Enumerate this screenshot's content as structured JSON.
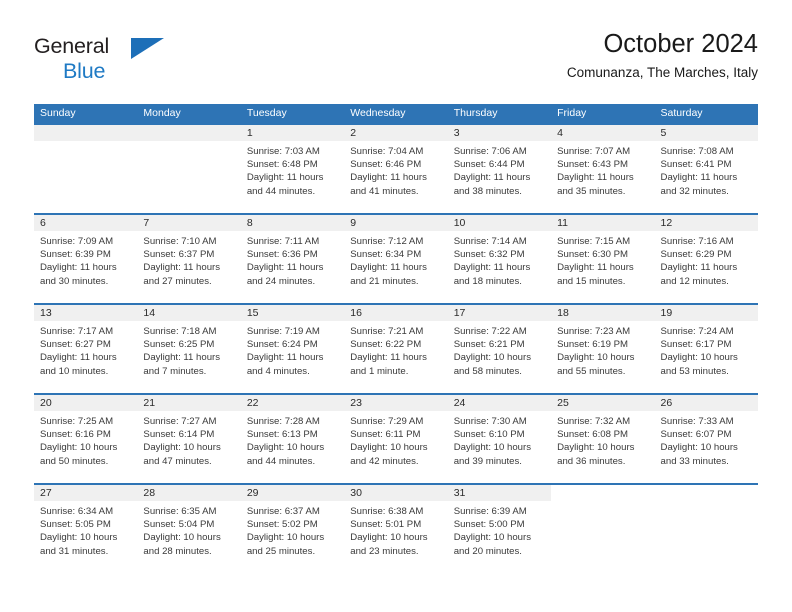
{
  "logo": {
    "line1": "General",
    "line2": "Blue",
    "triangle_color": "#1d6fb8"
  },
  "header": {
    "title": "October 2024",
    "subtitle": "Comunanza, The Marches, Italy"
  },
  "theme": {
    "header_blue": "#2E74B5",
    "day_band_gray": "#f0f0f0",
    "text": "#3a3a3a"
  },
  "weekdays": [
    "Sunday",
    "Monday",
    "Tuesday",
    "Wednesday",
    "Thursday",
    "Friday",
    "Saturday"
  ],
  "weeks": [
    [
      {
        "day": "",
        "blank": true,
        "sunrise": "",
        "sunset": "",
        "daylight_line1": "",
        "daylight_line2": ""
      },
      {
        "day": "",
        "blank": true,
        "sunrise": "",
        "sunset": "",
        "daylight_line1": "",
        "daylight_line2": ""
      },
      {
        "day": "1",
        "sunrise": "Sunrise: 7:03 AM",
        "sunset": "Sunset: 6:48 PM",
        "daylight_line1": "Daylight: 11 hours",
        "daylight_line2": "and 44 minutes."
      },
      {
        "day": "2",
        "sunrise": "Sunrise: 7:04 AM",
        "sunset": "Sunset: 6:46 PM",
        "daylight_line1": "Daylight: 11 hours",
        "daylight_line2": "and 41 minutes."
      },
      {
        "day": "3",
        "sunrise": "Sunrise: 7:06 AM",
        "sunset": "Sunset: 6:44 PM",
        "daylight_line1": "Daylight: 11 hours",
        "daylight_line2": "and 38 minutes."
      },
      {
        "day": "4",
        "sunrise": "Sunrise: 7:07 AM",
        "sunset": "Sunset: 6:43 PM",
        "daylight_line1": "Daylight: 11 hours",
        "daylight_line2": "and 35 minutes."
      },
      {
        "day": "5",
        "sunrise": "Sunrise: 7:08 AM",
        "sunset": "Sunset: 6:41 PM",
        "daylight_line1": "Daylight: 11 hours",
        "daylight_line2": "and 32 minutes."
      }
    ],
    [
      {
        "day": "6",
        "sunrise": "Sunrise: 7:09 AM",
        "sunset": "Sunset: 6:39 PM",
        "daylight_line1": "Daylight: 11 hours",
        "daylight_line2": "and 30 minutes."
      },
      {
        "day": "7",
        "sunrise": "Sunrise: 7:10 AM",
        "sunset": "Sunset: 6:37 PM",
        "daylight_line1": "Daylight: 11 hours",
        "daylight_line2": "and 27 minutes."
      },
      {
        "day": "8",
        "sunrise": "Sunrise: 7:11 AM",
        "sunset": "Sunset: 6:36 PM",
        "daylight_line1": "Daylight: 11 hours",
        "daylight_line2": "and 24 minutes."
      },
      {
        "day": "9",
        "sunrise": "Sunrise: 7:12 AM",
        "sunset": "Sunset: 6:34 PM",
        "daylight_line1": "Daylight: 11 hours",
        "daylight_line2": "and 21 minutes."
      },
      {
        "day": "10",
        "sunrise": "Sunrise: 7:14 AM",
        "sunset": "Sunset: 6:32 PM",
        "daylight_line1": "Daylight: 11 hours",
        "daylight_line2": "and 18 minutes."
      },
      {
        "day": "11",
        "sunrise": "Sunrise: 7:15 AM",
        "sunset": "Sunset: 6:30 PM",
        "daylight_line1": "Daylight: 11 hours",
        "daylight_line2": "and 15 minutes."
      },
      {
        "day": "12",
        "sunrise": "Sunrise: 7:16 AM",
        "sunset": "Sunset: 6:29 PM",
        "daylight_line1": "Daylight: 11 hours",
        "daylight_line2": "and 12 minutes."
      }
    ],
    [
      {
        "day": "13",
        "sunrise": "Sunrise: 7:17 AM",
        "sunset": "Sunset: 6:27 PM",
        "daylight_line1": "Daylight: 11 hours",
        "daylight_line2": "and 10 minutes."
      },
      {
        "day": "14",
        "sunrise": "Sunrise: 7:18 AM",
        "sunset": "Sunset: 6:25 PM",
        "daylight_line1": "Daylight: 11 hours",
        "daylight_line2": "and 7 minutes."
      },
      {
        "day": "15",
        "sunrise": "Sunrise: 7:19 AM",
        "sunset": "Sunset: 6:24 PM",
        "daylight_line1": "Daylight: 11 hours",
        "daylight_line2": "and 4 minutes."
      },
      {
        "day": "16",
        "sunrise": "Sunrise: 7:21 AM",
        "sunset": "Sunset: 6:22 PM",
        "daylight_line1": "Daylight: 11 hours",
        "daylight_line2": "and 1 minute."
      },
      {
        "day": "17",
        "sunrise": "Sunrise: 7:22 AM",
        "sunset": "Sunset: 6:21 PM",
        "daylight_line1": "Daylight: 10 hours",
        "daylight_line2": "and 58 minutes."
      },
      {
        "day": "18",
        "sunrise": "Sunrise: 7:23 AM",
        "sunset": "Sunset: 6:19 PM",
        "daylight_line1": "Daylight: 10 hours",
        "daylight_line2": "and 55 minutes."
      },
      {
        "day": "19",
        "sunrise": "Sunrise: 7:24 AM",
        "sunset": "Sunset: 6:17 PM",
        "daylight_line1": "Daylight: 10 hours",
        "daylight_line2": "and 53 minutes."
      }
    ],
    [
      {
        "day": "20",
        "sunrise": "Sunrise: 7:25 AM",
        "sunset": "Sunset: 6:16 PM",
        "daylight_line1": "Daylight: 10 hours",
        "daylight_line2": "and 50 minutes."
      },
      {
        "day": "21",
        "sunrise": "Sunrise: 7:27 AM",
        "sunset": "Sunset: 6:14 PM",
        "daylight_line1": "Daylight: 10 hours",
        "daylight_line2": "and 47 minutes."
      },
      {
        "day": "22",
        "sunrise": "Sunrise: 7:28 AM",
        "sunset": "Sunset: 6:13 PM",
        "daylight_line1": "Daylight: 10 hours",
        "daylight_line2": "and 44 minutes."
      },
      {
        "day": "23",
        "sunrise": "Sunrise: 7:29 AM",
        "sunset": "Sunset: 6:11 PM",
        "daylight_line1": "Daylight: 10 hours",
        "daylight_line2": "and 42 minutes."
      },
      {
        "day": "24",
        "sunrise": "Sunrise: 7:30 AM",
        "sunset": "Sunset: 6:10 PM",
        "daylight_line1": "Daylight: 10 hours",
        "daylight_line2": "and 39 minutes."
      },
      {
        "day": "25",
        "sunrise": "Sunrise: 7:32 AM",
        "sunset": "Sunset: 6:08 PM",
        "daylight_line1": "Daylight: 10 hours",
        "daylight_line2": "and 36 minutes."
      },
      {
        "day": "26",
        "sunrise": "Sunrise: 7:33 AM",
        "sunset": "Sunset: 6:07 PM",
        "daylight_line1": "Daylight: 10 hours",
        "daylight_line2": "and 33 minutes."
      }
    ],
    [
      {
        "day": "27",
        "sunrise": "Sunrise: 6:34 AM",
        "sunset": "Sunset: 5:05 PM",
        "daylight_line1": "Daylight: 10 hours",
        "daylight_line2": "and 31 minutes."
      },
      {
        "day": "28",
        "sunrise": "Sunrise: 6:35 AM",
        "sunset": "Sunset: 5:04 PM",
        "daylight_line1": "Daylight: 10 hours",
        "daylight_line2": "and 28 minutes."
      },
      {
        "day": "29",
        "sunrise": "Sunrise: 6:37 AM",
        "sunset": "Sunset: 5:02 PM",
        "daylight_line1": "Daylight: 10 hours",
        "daylight_line2": "and 25 minutes."
      },
      {
        "day": "30",
        "sunrise": "Sunrise: 6:38 AM",
        "sunset": "Sunset: 5:01 PM",
        "daylight_line1": "Daylight: 10 hours",
        "daylight_line2": "and 23 minutes."
      },
      {
        "day": "31",
        "sunrise": "Sunrise: 6:39 AM",
        "sunset": "Sunset: 5:00 PM",
        "daylight_line1": "Daylight: 10 hours",
        "daylight_line2": "and 20 minutes."
      },
      {
        "day": "",
        "empty": true,
        "sunrise": "",
        "sunset": "",
        "daylight_line1": "",
        "daylight_line2": ""
      },
      {
        "day": "",
        "empty": true,
        "sunrise": "",
        "sunset": "",
        "daylight_line1": "",
        "daylight_line2": ""
      }
    ]
  ]
}
